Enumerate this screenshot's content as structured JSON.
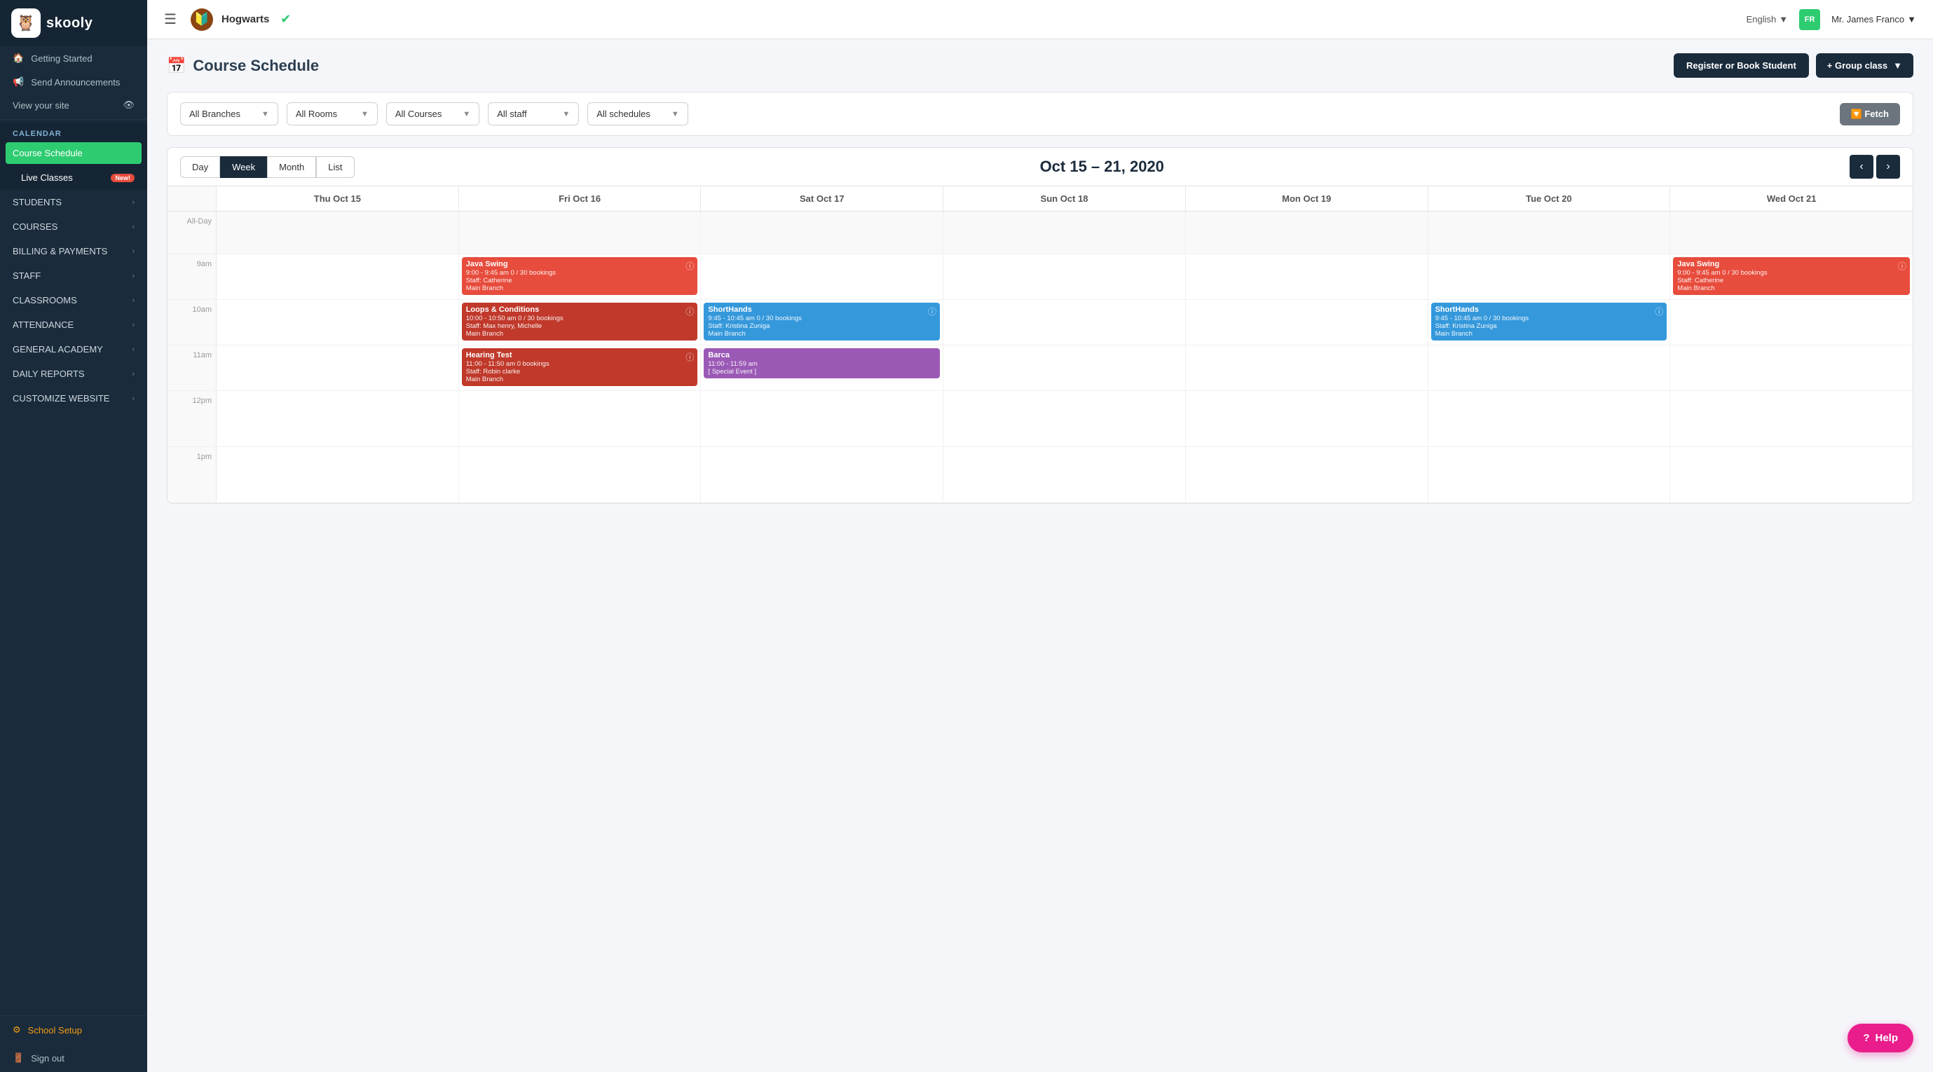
{
  "sidebar": {
    "logo": {
      "text": "skooly",
      "icon": "🦉"
    },
    "util_items": [
      {
        "id": "getting-started",
        "icon": "🏠",
        "label": "Getting Started"
      },
      {
        "id": "send-announcements",
        "icon": "📢",
        "label": "Send Announcements"
      }
    ],
    "view_site": {
      "label": "View your site",
      "icon": "👁"
    },
    "nav_sections": [
      {
        "id": "calendar",
        "label": "CALENDAR",
        "expanded": true,
        "children": [
          {
            "id": "course-schedule",
            "label": "Course Schedule",
            "active": true
          },
          {
            "id": "live-classes",
            "label": "Live Classes",
            "badge": "New!"
          }
        ]
      },
      {
        "id": "students",
        "label": "STUDENTS",
        "expanded": false
      },
      {
        "id": "courses",
        "label": "COURSES",
        "expanded": false
      },
      {
        "id": "billing",
        "label": "BILLING & PAYMENTS",
        "expanded": false
      },
      {
        "id": "staff",
        "label": "STAFF",
        "expanded": false
      },
      {
        "id": "classrooms",
        "label": "CLASSROOMS",
        "expanded": false
      },
      {
        "id": "attendance",
        "label": "ATTENDANCE",
        "expanded": false
      },
      {
        "id": "general-academy",
        "label": "GENERAL ACADEMY",
        "expanded": false
      },
      {
        "id": "daily-reports",
        "label": "DAILY REPORTS",
        "expanded": false
      },
      {
        "id": "customize-website",
        "label": "CUSTOMIZE WEBSITE",
        "expanded": false
      }
    ],
    "bottom": {
      "school_setup": {
        "label": "School Setup",
        "icon": "⚙"
      },
      "sign_out": {
        "label": "Sign out",
        "icon": "🚪"
      }
    }
  },
  "topbar": {
    "school": {
      "name": "Hogwarts",
      "logo": "🔰"
    },
    "language": {
      "label": "English",
      "chevron": "▼"
    },
    "user": {
      "initials": "FR",
      "name": "Mr. James Franco",
      "chevron": "▼"
    }
  },
  "page": {
    "title": "Course Schedule",
    "title_icon": "📅",
    "actions": {
      "register_label": "Register or Book Student",
      "group_class_label": "+ Group class",
      "group_class_chevron": "▼"
    }
  },
  "filters": {
    "branches": {
      "selected": "All Branches",
      "chevron": "▼"
    },
    "rooms": {
      "selected": "All Rooms",
      "chevron": "▼"
    },
    "courses": {
      "selected": "All Courses",
      "chevron": "▼"
    },
    "staff": {
      "selected": "All staff",
      "chevron": "▼"
    },
    "schedules": {
      "selected": "All schedules",
      "chevron": "▼"
    },
    "fetch_label": "🔽 Fetch"
  },
  "calendar": {
    "view_buttons": [
      "Day",
      "Week",
      "Month",
      "List"
    ],
    "active_view": "Week",
    "title": "Oct 15 – 21, 2020",
    "columns": [
      {
        "label": "Thu Oct 15"
      },
      {
        "label": "Fri Oct 16"
      },
      {
        "label": "Sat Oct 17"
      },
      {
        "label": "Sun Oct 18"
      },
      {
        "label": "Mon Oct 19"
      },
      {
        "label": "Tue Oct 20"
      },
      {
        "label": "Wed Oct 21"
      }
    ],
    "time_slots": [
      "All-Day",
      "9am",
      "10am",
      "11am",
      "12pm",
      "1pm"
    ],
    "events": [
      {
        "id": "java-swing-fri",
        "title": "Java Swing",
        "time": "9:00 - 9:45 am 0 / 30 bookings",
        "staff": "Staff: Catherine",
        "branch": "Main Branch",
        "color": "event-red",
        "slot": "9am",
        "col": 1
      },
      {
        "id": "loops-fri",
        "title": "Loops & Conditions",
        "time": "10:00 - 10:50 am 0 / 30 bookings",
        "staff": "Staff: Max henry, Michelle",
        "branch": "Main Branch",
        "color": "event-pink",
        "slot": "10am",
        "col": 1
      },
      {
        "id": "hearing-test-fri",
        "title": "Hearing Test",
        "time": "11:00 - 11:50 am 0 bookings",
        "staff": "Staff: Robin clarke",
        "branch": "Main Branch",
        "color": "event-pink",
        "slot": "11am",
        "col": 1
      },
      {
        "id": "shorthands-sat",
        "title": "ShortHands",
        "time": "9:45 - 10:45 am 0 / 30 bookings",
        "staff": "Staff: Kristina Zuniga",
        "branch": "Main Branch",
        "color": "event-blue",
        "slot": "10am",
        "col": 2
      },
      {
        "id": "barca-sat",
        "title": "Barca",
        "time": "11:00 - 11:59 am",
        "staff": "[ Special Event ]",
        "branch": "",
        "color": "event-purple",
        "slot": "11am",
        "col": 2
      },
      {
        "id": "shorthands-tue",
        "title": "ShortHands",
        "time": "9:45 - 10:45 am 0 / 30 bookings",
        "staff": "Staff: Kristina Zuniga",
        "branch": "Main Branch",
        "color": "event-blue",
        "slot": "10am",
        "col": 5
      },
      {
        "id": "java-swing-wed",
        "title": "Java Swing",
        "time": "9:00 - 9:45 am 0 / 30 bookings",
        "staff": "Staff: Catherine",
        "branch": "Main Branch",
        "color": "event-red",
        "slot": "9am",
        "col": 6
      }
    ]
  },
  "help": {
    "label": "Help"
  }
}
